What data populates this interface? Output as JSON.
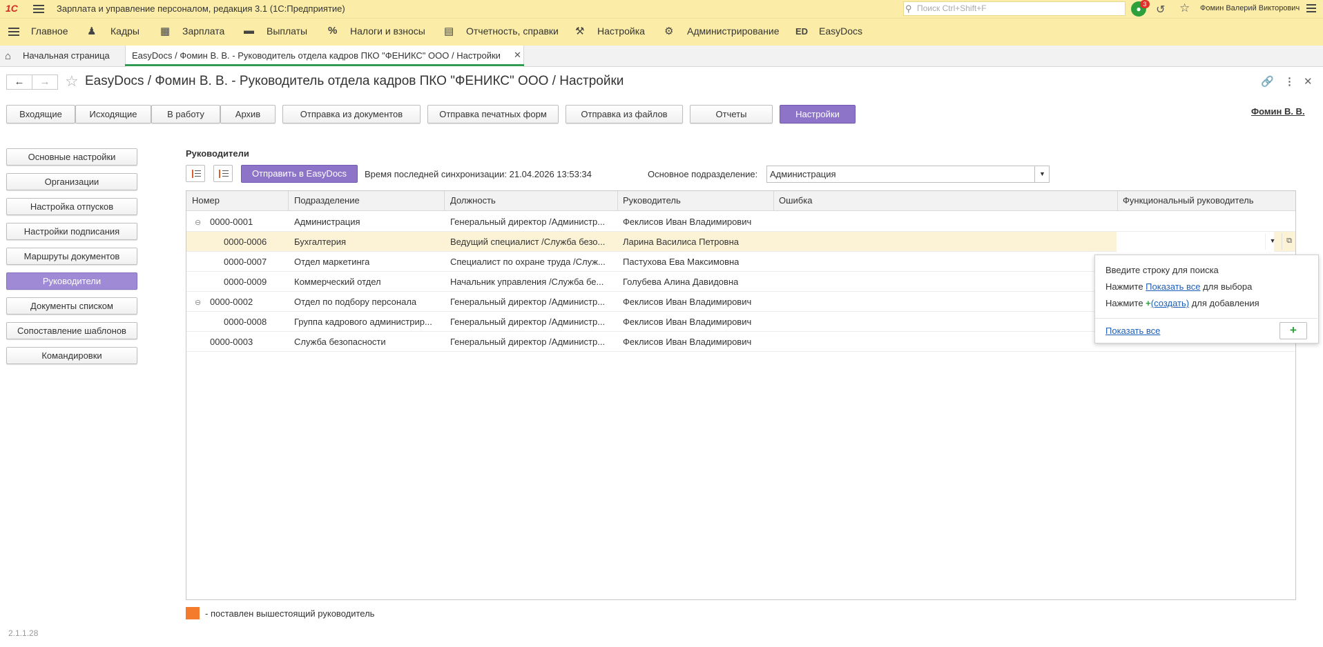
{
  "app": {
    "logo": "1С",
    "title": "Зарплата и управление персоналом, редакция 3.1  (1С:Предприятие)",
    "search_placeholder": "Поиск Ctrl+Shift+F",
    "notifications_count": "3",
    "user": "Фомин Валерий Викторович"
  },
  "main_menu": [
    {
      "label": "Главное",
      "icon": "menu-icon"
    },
    {
      "label": "Кадры",
      "icon": "people-icon"
    },
    {
      "label": "Зарплата",
      "icon": "calculator-icon"
    },
    {
      "label": "Выплаты",
      "icon": "wallet-icon"
    },
    {
      "label": "Налоги и взносы",
      "icon": "percent-icon"
    },
    {
      "label": "Отчетность, справки",
      "icon": "reports-icon"
    },
    {
      "label": "Настройка",
      "icon": "wrench-icon"
    },
    {
      "label": "Администрирование",
      "icon": "gear-icon"
    },
    {
      "label": "EasyDocs",
      "icon": "ed-icon"
    }
  ],
  "tabs": {
    "home": "Начальная страница",
    "active": "EasyDocs / Фомин В. В. - Руководитель отдела кадров ПКО \"ФЕНИКС\" ООО / Настройки"
  },
  "page": {
    "title": "EasyDocs / Фомин В. В. - Руководитель отдела кадров ПКО \"ФЕНИКС\" ООО / Настройки",
    "user_link": "Фомин В. В."
  },
  "top_buttons": [
    "Входящие",
    "Исходящие",
    "В работу",
    "Архив",
    "Отправка из документов",
    "Отправка печатных форм",
    "Отправка из файлов",
    "Отчеты",
    "Настройки"
  ],
  "left_menu": [
    "Основные настройки",
    "Организации",
    "Настройка отпусков",
    "Настройки подписания",
    "Маршруты документов",
    "Руководители",
    "Документы списком",
    "Сопоставление шаблонов",
    "Командировки"
  ],
  "content": {
    "section_title": "Руководители",
    "send_button": "Отправить в EasyDocs",
    "sync_label": "Время последней синхронизации: 21.04.2026 13:53:34",
    "dept_label": "Основное подразделение:",
    "dept_value": "Администрация"
  },
  "table": {
    "columns": [
      "Номер",
      "Подразделение",
      "Должность",
      "Руководитель",
      "Ошибка",
      "Функциональный руководитель"
    ],
    "rows": [
      {
        "number": "0000-0001",
        "dept": "Администрация",
        "position": "Генеральный директор /Администр...",
        "manager": "Феклисов Иван Владимирович"
      },
      {
        "number": "0000-0006",
        "dept": "Бухгалтерия",
        "position": "Ведущий специалист /Служба безо...",
        "manager": "Ларина Василиса Петровна"
      },
      {
        "number": "0000-0007",
        "dept": "Отдел маркетинга",
        "position": "Специалист по охране труда /Служ...",
        "manager": "Пастухова Ева Максимовна"
      },
      {
        "number": "0000-0009",
        "dept": "Коммерческий отдел",
        "position": "Начальник управления /Служба бе...",
        "manager": "Голубева Алина Давидовна"
      },
      {
        "number": "0000-0002",
        "dept": "Отдел по подбору персонала",
        "position": "Генеральный директор /Администр...",
        "manager": "Феклисов Иван Владимирович"
      },
      {
        "number": "0000-0008",
        "dept": "Группа кадрового администрир...",
        "position": "Генеральный директор /Администр...",
        "manager": "Феклисов Иван Владимирович"
      },
      {
        "number": "0000-0003",
        "dept": "Служба безопасности",
        "position": "Генеральный директор /Администр...",
        "manager": "Феклисов Иван Владимирович"
      }
    ]
  },
  "popup": {
    "line1": "Введите строку для поиска",
    "line2_pre": "Нажмите ",
    "line2_link": "Показать все",
    "line2_post": " для выбора",
    "line3_pre": "Нажмите ",
    "line3_link": "(создать)",
    "line3_post": " для добавления",
    "show_all": "Показать все"
  },
  "legend": "- поставлен вышестоящий руководитель",
  "version": "2.1.1.28",
  "colors": {
    "accent": "#8d74c9",
    "header_bg": "#fbeda7",
    "legend_marker": "#f47b2b",
    "selected_row": "#fcf3d6",
    "active_tab_underline": "#2f9c52"
  }
}
